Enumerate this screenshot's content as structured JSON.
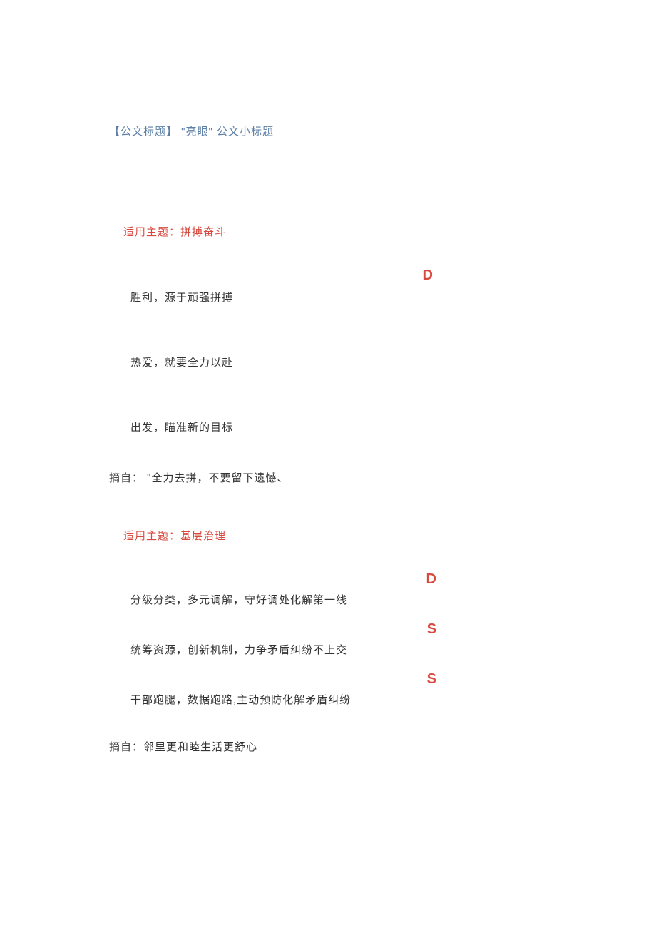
{
  "page_title": "【公文标题】 \"亮眼\" 公文小标题",
  "sections": [
    {
      "theme": "适用主题：拼搏奋斗",
      "items": [
        {
          "marker": "D",
          "text": "胜利，源于顽强拼搏"
        },
        {
          "marker": "",
          "text": "热爱，就要全力以赴"
        },
        {
          "marker": "",
          "text": "出发，瞄准新的目标"
        }
      ],
      "source": "摘自： \"全力去拼，不要留下遗憾、"
    },
    {
      "theme": "适用主题：基层治理",
      "items": [
        {
          "marker": "D",
          "text": "分级分类，多元调解，守好调处化解第一线"
        },
        {
          "marker": "S",
          "text": "统筹资源，创新机制，力争矛盾纠纷不上交"
        },
        {
          "marker": "S",
          "text": "干部跑腿，数据跑路,主动预防化解矛盾纠纷"
        }
      ],
      "source": "摘自：邻里更和睦生活更舒心"
    }
  ]
}
